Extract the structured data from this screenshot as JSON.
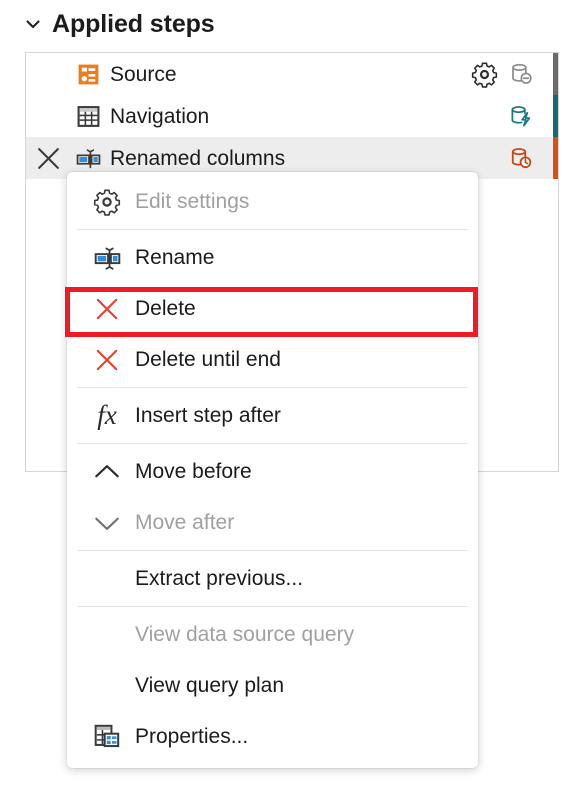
{
  "panel": {
    "title": "Applied steps",
    "collapse_icon": "chevron-down-icon"
  },
  "steps": [
    {
      "label": "Source",
      "icon": "source-table-icon",
      "has_gear": true,
      "gear_icon": "gear-icon",
      "db_icon": "database-minus-icon",
      "db_color": "#8a8a8a",
      "bar_color": "#6b6b6b",
      "hovered": false,
      "show_delete": false
    },
    {
      "label": "Navigation",
      "icon": "table-grid-icon",
      "has_gear": false,
      "gear_icon": "",
      "db_icon": "database-lightning-icon",
      "db_color": "#1a7a80",
      "bar_color": "#126b72",
      "hovered": false,
      "show_delete": false
    },
    {
      "label": "Renamed columns",
      "icon": "rename-columns-icon",
      "has_gear": false,
      "gear_icon": "",
      "db_icon": "database-clock-icon",
      "db_color": "#c84610",
      "bar_color": "#d9500f",
      "hovered": true,
      "show_delete": true,
      "delete_icon": "close-x-icon"
    }
  ],
  "context_menu": {
    "items": [
      {
        "label": "Edit settings",
        "icon": "gear-icon",
        "disabled": true,
        "separator_after": true
      },
      {
        "label": "Rename",
        "icon": "rename-icon",
        "disabled": false,
        "separator_after": false
      },
      {
        "label": "Delete",
        "icon": "delete-x-icon",
        "disabled": false,
        "separator_after": false,
        "highlighted": true
      },
      {
        "label": "Delete until end",
        "icon": "delete-x-icon",
        "disabled": false,
        "separator_after": true
      },
      {
        "label": "Insert step after",
        "icon": "fx-icon",
        "disabled": false,
        "separator_after": true
      },
      {
        "label": "Move before",
        "icon": "chevron-up-icon",
        "disabled": false,
        "separator_after": false
      },
      {
        "label": "Move after",
        "icon": "chevron-down-icon",
        "disabled": true,
        "separator_after": true
      },
      {
        "label": "Extract previous...",
        "icon": "",
        "disabled": false,
        "separator_after": true
      },
      {
        "label": "View data source query",
        "icon": "",
        "disabled": true,
        "separator_after": false
      },
      {
        "label": "View query plan",
        "icon": "",
        "disabled": false,
        "separator_after": false
      },
      {
        "label": "Properties...",
        "icon": "properties-icon",
        "disabled": false,
        "separator_after": false
      }
    ]
  },
  "annotation": {
    "highlight_color": "#ED1C24",
    "highlight_target": "Delete"
  }
}
